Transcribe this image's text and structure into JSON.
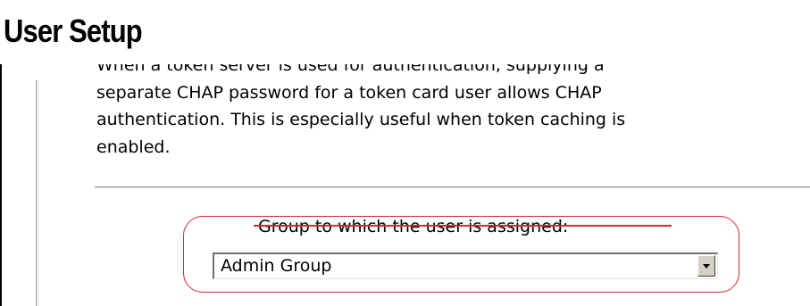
{
  "page": {
    "title": "User Setup"
  },
  "help_text": {
    "lines": [
      "When a token server is used for authentication, supplying a",
      "separate CHAP password for a token card user allows CHAP",
      "authentication. This is especially useful when token caching is",
      "enabled."
    ]
  },
  "group_field": {
    "label": "Group to which the user is assigned:",
    "selected_value": "Admin Group",
    "dropdown_icon": "chevron-down-icon"
  },
  "colors": {
    "highlight": "#d32b2b",
    "dropdown_button": "#d4d0c8"
  }
}
